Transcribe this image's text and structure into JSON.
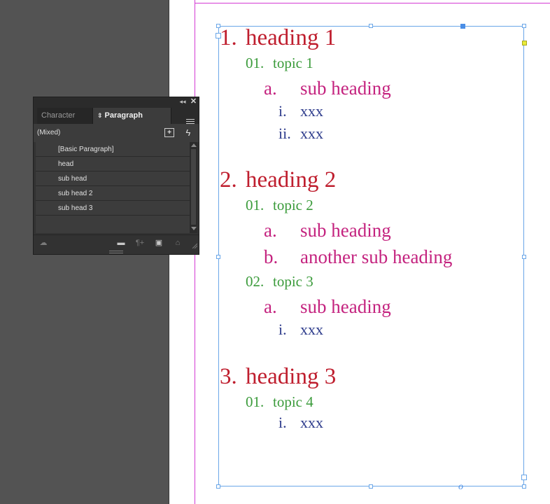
{
  "panel": {
    "tabs": [
      {
        "label": "Character Styl",
        "active": false
      },
      {
        "label": "Paragraph Styles",
        "active": true
      }
    ],
    "collapse_icon": "double-chevron-left-icon",
    "close_icon": "close-icon",
    "menu_icon": "hamburger-menu-icon",
    "current_style": "(Mixed)",
    "styles": [
      "[Basic Paragraph]",
      "head",
      "sub head",
      "sub head 2",
      "sub head 3"
    ],
    "footer_icons": [
      "cc-libraries-icon",
      "folder-icon",
      "clear-overrides-icon",
      "new-style-icon",
      "trash-icon"
    ]
  },
  "document": {
    "text_color_heading": "#bf1e2e",
    "text_color_topic": "#3b9b3b",
    "text_color_sub": "#c4237f",
    "text_color_item": "#2e3c8c",
    "lines": [
      {
        "level": "h1",
        "num": "1.",
        "text": "heading 1"
      },
      {
        "level": "topic",
        "num": "01.",
        "text": "topic 1"
      },
      {
        "level": "sub",
        "num": "a.",
        "text": "sub heading"
      },
      {
        "level": "item",
        "num": "i.",
        "text": "xxx"
      },
      {
        "level": "item",
        "num": "ii.",
        "text": "xxx"
      },
      {
        "level": "h1",
        "num": "2.",
        "text": "heading 2"
      },
      {
        "level": "topic",
        "num": "01.",
        "text": "topic 2"
      },
      {
        "level": "sub",
        "num": "a.",
        "text": "sub heading"
      },
      {
        "level": "sub",
        "num": "b.",
        "text": "another sub heading"
      },
      {
        "level": "topic",
        "num": "02.",
        "text": "topic 3"
      },
      {
        "level": "sub",
        "num": "a.",
        "text": "sub heading"
      },
      {
        "level": "item",
        "num": "i.",
        "text": "xxx"
      },
      {
        "level": "h1",
        "num": "3.",
        "text": "heading 3"
      },
      {
        "level": "topic",
        "num": "01.",
        "text": "topic 4"
      },
      {
        "level": "item",
        "num": "i.",
        "text": "xxx"
      }
    ]
  }
}
